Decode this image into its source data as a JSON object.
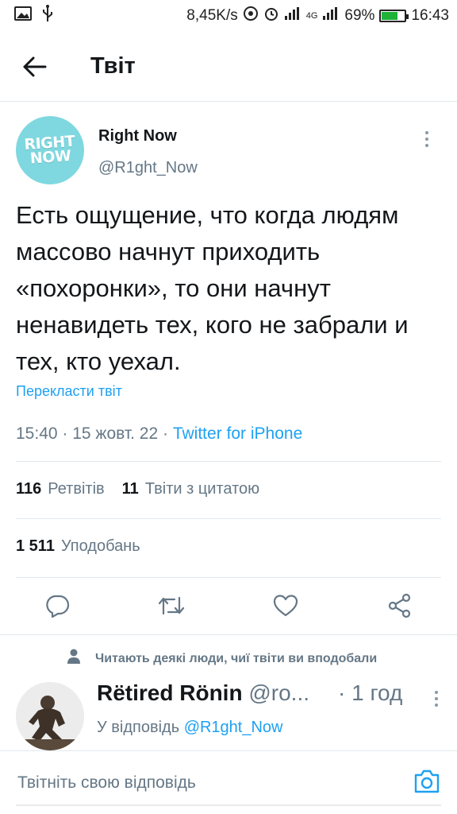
{
  "status_bar": {
    "speed": "8,45K/s",
    "network": "4G",
    "battery": "69%",
    "battery_level": 0.69,
    "time": "16:43"
  },
  "header": {
    "title": "Твіт"
  },
  "tweet": {
    "author_name": "Right Now",
    "author_handle": "@R1ght_Now",
    "avatar_text": "RIGHT NOW",
    "text": "Есть ощущение, что когда людям массово начнут приходить «похоронки», то они начнут ненавидеть тех, кого не забрали и тех, кто уехал.",
    "translate_label": "Перекласти твіт",
    "time": "15:40",
    "date": "15 жовт. 22",
    "source": "Twitter for iPhone",
    "retweets_count": "116",
    "retweets_label": "Ретвітів",
    "quotes_count": "11",
    "quotes_label": "Твіти з цитатою",
    "likes_count": "1 511",
    "likes_label": "Уподобань"
  },
  "reply": {
    "context": "Читають деякі люди, чиї твіти ви вподобали",
    "author_name": "Rëtired Rönin",
    "author_handle": "@ro...",
    "time": "· 1 год",
    "replying_to_label": "У відповідь",
    "replying_to_handle": "@R1ght_Now"
  },
  "compose": {
    "placeholder": "Твітніть свою відповідь"
  },
  "colors": {
    "accent": "#1da1f2",
    "muted": "#657786",
    "avatar_bg": "#7fd8e0",
    "battery": "#1fb13a"
  }
}
